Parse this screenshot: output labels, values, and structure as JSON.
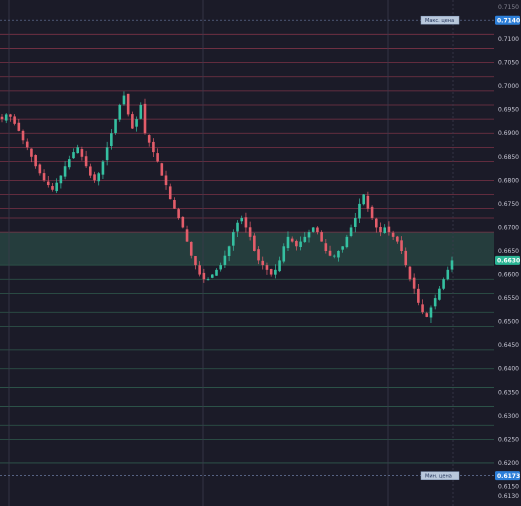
{
  "chart_data": {
    "type": "candlestick",
    "title": "",
    "xlabel": "",
    "ylabel": "",
    "ylim": [
      0.613,
      0.718
    ],
    "y_ticks": [
      "0.7100",
      "0.7050",
      "0.7000",
      "0.6950",
      "0.6900",
      "0.6850",
      "0.6800",
      "0.6750",
      "0.6700",
      "0.6650",
      "0.6600",
      "0.6550",
      "0.6500",
      "0.6450",
      "0.6400",
      "0.6350",
      "0.6300",
      "0.6250",
      "0.6200",
      "0.6150",
      "0.6130"
    ],
    "max_price_badge": "0.7140",
    "min_price_badge": "0.6173",
    "current_price_badge": "0.6630",
    "max_label": "Макс. цена",
    "min_label": "Мин. цена",
    "top_cut_tick": "0.7150",
    "highlight_zone": [
      0.662,
      0.669
    ],
    "level_lines_red": [
      0.711,
      0.708,
      0.705,
      0.702,
      0.699,
      0.696,
      0.693,
      0.69,
      0.687,
      0.684,
      0.68,
      0.677,
      0.674,
      0.672,
      0.669
    ],
    "level_lines_green": [
      0.662,
      0.659,
      0.656,
      0.652,
      0.649,
      0.644,
      0.64,
      0.636,
      0.632,
      0.628,
      0.625,
      0.62
    ],
    "close_path": [
      0.693,
      0.694,
      0.6935,
      0.692,
      0.6905,
      0.6885,
      0.687,
      0.685,
      0.683,
      0.6815,
      0.68,
      0.679,
      0.678,
      0.6795,
      0.681,
      0.683,
      0.6845,
      0.686,
      0.687,
      0.685,
      0.683,
      0.681,
      0.68,
      0.6815,
      0.684,
      0.687,
      0.69,
      0.693,
      0.696,
      0.698,
      0.694,
      0.691,
      0.693,
      0.696,
      0.69,
      0.688,
      0.686,
      0.684,
      0.681,
      0.679,
      0.676,
      0.674,
      0.672,
      0.67,
      0.667,
      0.664,
      0.662,
      0.66,
      0.659,
      0.659,
      0.66,
      0.661,
      0.662,
      0.664,
      0.666,
      0.669,
      0.671,
      0.672,
      0.67,
      0.668,
      0.665,
      0.663,
      0.662,
      0.661,
      0.66,
      0.661,
      0.663,
      0.666,
      0.668,
      0.667,
      0.666,
      0.667,
      0.668,
      0.669,
      0.67,
      0.669,
      0.667,
      0.665,
      0.664,
      0.664,
      0.665,
      0.666,
      0.668,
      0.67,
      0.672,
      0.675,
      0.677,
      0.674,
      0.672,
      0.67,
      0.669,
      0.67,
      0.669,
      0.668,
      0.667,
      0.665,
      0.662,
      0.659,
      0.657,
      0.654,
      0.652,
      0.651,
      0.653,
      0.655,
      0.657,
      0.659,
      0.661,
      0.663
    ]
  }
}
